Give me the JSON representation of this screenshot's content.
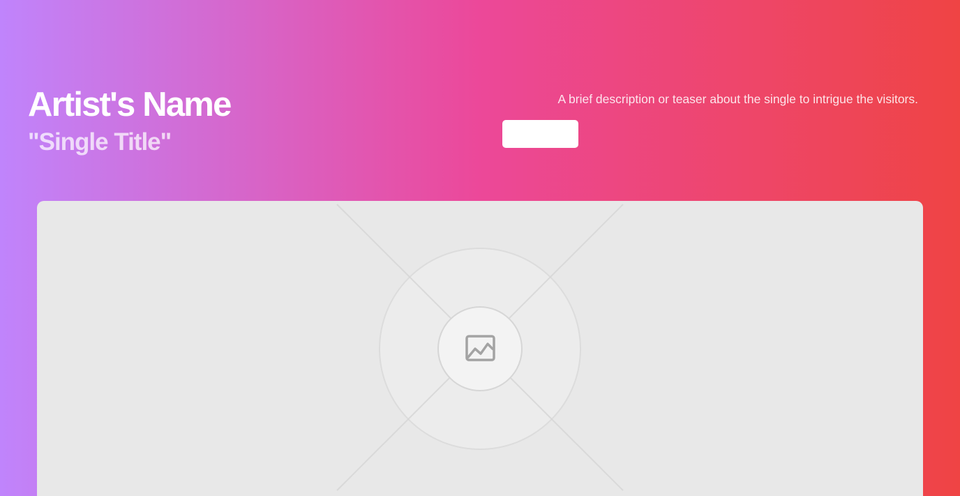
{
  "hero": {
    "artist_name": "Artist's Name",
    "single_title": "\"Single Title\"",
    "description": "A brief description or teaser about the single to intrigue the visitors.",
    "cta_label": ""
  },
  "cover": {
    "placeholder_icon": "image-icon"
  },
  "colors": {
    "gradient_start": "#c084fc",
    "gradient_mid": "#ec4899",
    "gradient_end": "#ef4444",
    "card_background": "#e8e8e8",
    "button_background": "#ffffff"
  }
}
